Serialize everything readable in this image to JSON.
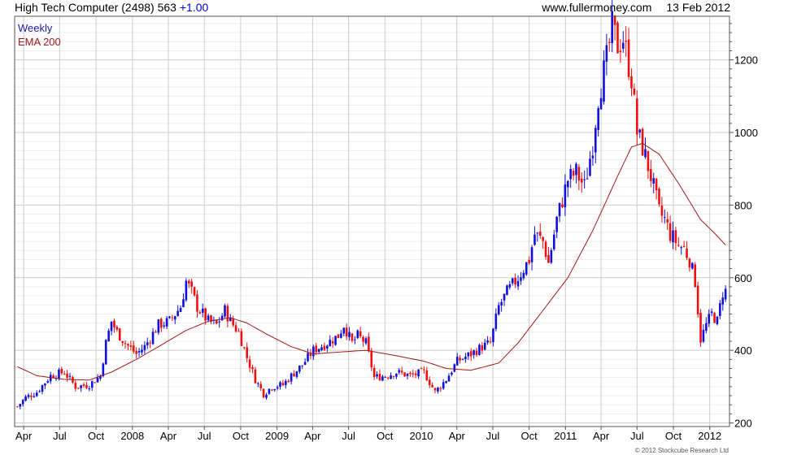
{
  "header": {
    "stock": "High Tech Computer (2498)",
    "price": "563",
    "change": "+1.00",
    "site": "www.fullermoney.com",
    "date": "13 Feb 2012"
  },
  "legend": {
    "period": "Weekly",
    "ema": "EMA 200"
  },
  "copyright": "© 2012 Stockcube Research Ltd",
  "colors": {
    "up": "#1010dd",
    "down": "#ee1010",
    "ema": "#a01818",
    "grid": "#cccccc",
    "period_label": "#1a1aaa"
  },
  "chart_data": {
    "type": "candlestick",
    "title": "High Tech Computer (2498) 563 +1.00",
    "frequency": "Weekly",
    "ylim": [
      190,
      1320
    ],
    "y_ticks": [
      200,
      400,
      600,
      800,
      1000,
      1200
    ],
    "x_ticks": [
      "Apr",
      "Jul",
      "Oct",
      "2008",
      "Apr",
      "Jul",
      "Oct",
      "2009",
      "Apr",
      "Jul",
      "Oct",
      "2010",
      "Apr",
      "Jul",
      "Oct",
      "2011",
      "Apr",
      "Jul",
      "Oct",
      "2012"
    ],
    "grid": true,
    "legend_position": "top-left",
    "close_anchors": [
      [
        "2007-03-16",
        245
      ],
      [
        "2007-04-06",
        270
      ],
      [
        "2007-05-04",
        285
      ],
      [
        "2007-06-08",
        330
      ],
      [
        "2007-07-13",
        340
      ],
      [
        "2007-08-10",
        300
      ],
      [
        "2007-09-14",
        305
      ],
      [
        "2007-10-12",
        330
      ],
      [
        "2007-10-26",
        420
      ],
      [
        "2007-11-09",
        480
      ],
      [
        "2007-11-23",
        450
      ],
      [
        "2007-12-14",
        420
      ],
      [
        "2008-01-11",
        390
      ],
      [
        "2008-02-01",
        410
      ],
      [
        "2008-03-07",
        470
      ],
      [
        "2008-04-04",
        480
      ],
      [
        "2008-05-02",
        520
      ],
      [
        "2008-05-16",
        590
      ],
      [
        "2008-05-30",
        560
      ],
      [
        "2008-06-13",
        520
      ],
      [
        "2008-07-11",
        480
      ],
      [
        "2008-08-01",
        470
      ],
      [
        "2008-08-22",
        510
      ],
      [
        "2008-09-05",
        480
      ],
      [
        "2008-09-26",
        450
      ],
      [
        "2008-10-17",
        380
      ],
      [
        "2008-11-07",
        320
      ],
      [
        "2008-11-28",
        280
      ],
      [
        "2008-12-19",
        300
      ],
      [
        "2009-01-16",
        305
      ],
      [
        "2009-02-06",
        330
      ],
      [
        "2009-03-06",
        360
      ],
      [
        "2009-04-03",
        400
      ],
      [
        "2009-05-08",
        420
      ],
      [
        "2009-06-05",
        440
      ],
      [
        "2009-06-19",
        470
      ],
      [
        "2009-07-10",
        420
      ],
      [
        "2009-07-24",
        440
      ],
      [
        "2009-08-14",
        420
      ],
      [
        "2009-09-04",
        325
      ],
      [
        "2009-10-02",
        330
      ],
      [
        "2009-10-30",
        340
      ],
      [
        "2009-12-04",
        330
      ],
      [
        "2010-01-08",
        340
      ],
      [
        "2010-02-05",
        285
      ],
      [
        "2010-03-05",
        320
      ],
      [
        "2010-04-02",
        370
      ],
      [
        "2010-05-07",
        390
      ],
      [
        "2010-06-04",
        410
      ],
      [
        "2010-06-25",
        420
      ],
      [
        "2010-07-16",
        520
      ],
      [
        "2010-08-06",
        560
      ],
      [
        "2010-09-03",
        600
      ],
      [
        "2010-10-01",
        650
      ],
      [
        "2010-10-15",
        720
      ],
      [
        "2010-11-05",
        700
      ],
      [
        "2010-11-19",
        640
      ],
      [
        "2010-12-10",
        760
      ],
      [
        "2011-01-07",
        870
      ],
      [
        "2011-01-28",
        890
      ],
      [
        "2011-02-18",
        850
      ],
      [
        "2011-03-11",
        970
      ],
      [
        "2011-03-25",
        1100
      ],
      [
        "2011-04-15",
        1200
      ],
      [
        "2011-04-29",
        1290
      ],
      [
        "2011-05-13",
        1240
      ],
      [
        "2011-05-27",
        1260
      ],
      [
        "2011-06-17",
        1150
      ],
      [
        "2011-07-01",
        1000
      ],
      [
        "2011-07-15",
        960
      ],
      [
        "2011-08-05",
        880
      ],
      [
        "2011-08-26",
        780
      ],
      [
        "2011-09-09",
        760
      ],
      [
        "2011-09-23",
        720
      ],
      [
        "2011-10-14",
        690
      ],
      [
        "2011-10-28",
        680
      ],
      [
        "2011-11-11",
        650
      ],
      [
        "2011-11-25",
        590
      ],
      [
        "2011-12-09",
        430
      ],
      [
        "2011-12-23",
        470
      ],
      [
        "2012-01-06",
        500
      ],
      [
        "2012-01-20",
        480
      ],
      [
        "2012-02-03",
        560
      ],
      [
        "2012-02-10",
        563
      ]
    ],
    "ema200_anchors": [
      [
        "2007-03-16",
        355
      ],
      [
        "2007-05-04",
        330
      ],
      [
        "2007-07-13",
        320
      ],
      [
        "2007-09-14",
        318
      ],
      [
        "2007-11-09",
        340
      ],
      [
        "2008-01-11",
        375
      ],
      [
        "2008-03-07",
        410
      ],
      [
        "2008-05-16",
        455
      ],
      [
        "2008-07-11",
        480
      ],
      [
        "2008-09-05",
        490
      ],
      [
        "2008-10-17",
        475
      ],
      [
        "2008-12-05",
        445
      ],
      [
        "2009-02-06",
        410
      ],
      [
        "2009-04-03",
        390
      ],
      [
        "2009-06-05",
        395
      ],
      [
        "2009-08-14",
        400
      ],
      [
        "2009-10-30",
        385
      ],
      [
        "2010-01-08",
        370
      ],
      [
        "2010-03-05",
        350
      ],
      [
        "2010-05-07",
        345
      ],
      [
        "2010-07-16",
        365
      ],
      [
        "2010-09-03",
        420
      ],
      [
        "2010-11-05",
        510
      ],
      [
        "2011-01-07",
        600
      ],
      [
        "2011-03-11",
        730
      ],
      [
        "2011-05-13",
        880
      ],
      [
        "2011-06-17",
        960
      ],
      [
        "2011-07-15",
        970
      ],
      [
        "2011-08-26",
        940
      ],
      [
        "2011-10-14",
        860
      ],
      [
        "2011-12-09",
        760
      ],
      [
        "2012-01-20",
        715
      ],
      [
        "2012-02-10",
        690
      ]
    ]
  }
}
